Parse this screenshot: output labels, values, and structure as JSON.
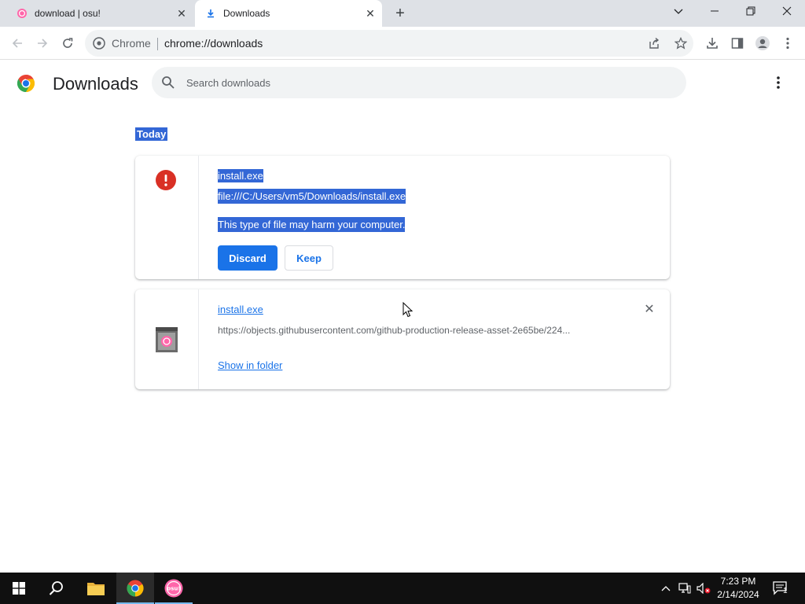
{
  "browser": {
    "tabs": [
      {
        "title": "download | osu!",
        "active": false
      },
      {
        "title": "Downloads",
        "active": true
      }
    ],
    "omnibox": {
      "chip": "Chrome",
      "url": "chrome://downloads"
    }
  },
  "downloads_page": {
    "title": "Downloads",
    "search_placeholder": "Search downloads",
    "date_header": "Today",
    "items": [
      {
        "name": "install.exe",
        "path": "file:///C:/Users/vm5/Downloads/install.exe",
        "warning": "This type of file may harm your computer.",
        "discard_label": "Discard",
        "keep_label": "Keep"
      },
      {
        "name": "install.exe",
        "url": "https://objects.githubusercontent.com/github-production-release-asset-2e65be/224...",
        "show_in_folder_label": "Show in folder"
      }
    ]
  },
  "taskbar": {
    "time": "7:23 PM",
    "date": "2/14/2024",
    "notification_count": "1"
  },
  "colors": {
    "accent": "#1a73e8",
    "selection": "#3367d6",
    "warning_red": "#d93025",
    "osu_pink": "#ff66aa"
  }
}
